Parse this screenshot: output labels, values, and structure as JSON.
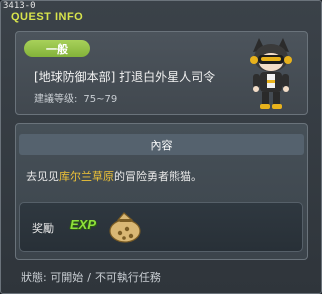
{
  "quest": {
    "id": "3413-0",
    "window_title": "QUEST INFO",
    "category_badge": "一般",
    "name": "[地球防御本部] 打退白外星人司令",
    "level_label": "建議等级:",
    "level_range": "75~79"
  },
  "content": {
    "header": "內容",
    "desc_prefix": "去见见",
    "desc_highlight": "库尔兰草原",
    "desc_suffix": "的冒险勇者熊猫。"
  },
  "reward": {
    "label": "奖勵",
    "exp_text": "EXP",
    "item_icon": "money-bag-icon"
  },
  "status": {
    "label": "狀態:",
    "value": "可開始",
    "separator": "/",
    "note": "不可執行任務"
  },
  "colors": {
    "title": "#d8e44c",
    "badge": "#9ccc4e",
    "highlight": "#f0c437",
    "exp": "#8fe03c"
  }
}
